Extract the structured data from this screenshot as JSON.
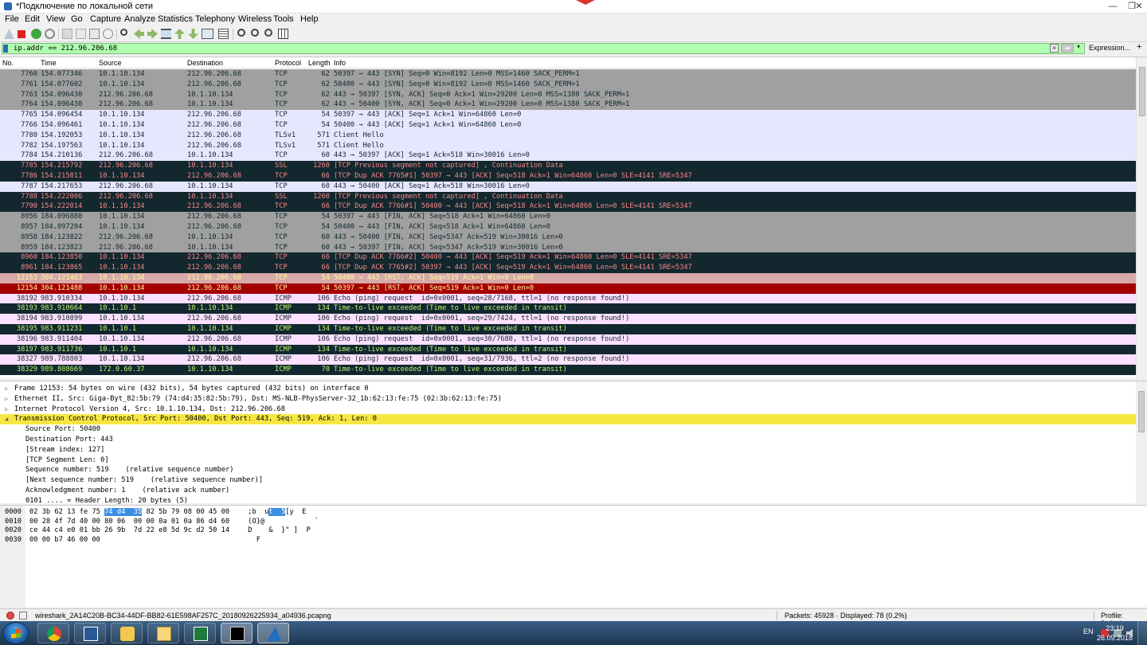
{
  "window": {
    "title": "*Подключение по локальной сети",
    "minimize": "—",
    "maximize": "❐",
    "close": "✕"
  },
  "menu": [
    "File",
    "Edit",
    "View",
    "Go",
    "Capture",
    "Analyze",
    "Statistics",
    "Telephony",
    "Wireless",
    "Tools",
    "Help"
  ],
  "filter": {
    "value": "ip.addr == 212.96.206.68",
    "clear_label": "✕",
    "apply_label": "➡",
    "dropdown": "▾",
    "expression_label": "Expression...",
    "add_label": "+"
  },
  "packet_list": {
    "columns": [
      "No.",
      "Time",
      "Source",
      "Destination",
      "Protocol",
      "Length",
      "Info"
    ],
    "rows": [
      {
        "no": "7760",
        "time": "154.077346",
        "src": "10.1.10.134",
        "dst": "212.96.206.68",
        "proto": "TCP",
        "len": "62",
        "info": "50397 → 443 [SYN] Seq=0 Win=8192 Len=0 MSS=1460 SACK_PERM=1",
        "bg": "#a0a0a0",
        "fg": "#12272e"
      },
      {
        "no": "7761",
        "time": "154.077602",
        "src": "10.1.10.134",
        "dst": "212.96.206.68",
        "proto": "TCP",
        "len": "62",
        "info": "50400 → 443 [SYN] Seq=0 Win=8192 Len=0 MSS=1460 SACK_PERM=1",
        "bg": "#a0a0a0",
        "fg": "#12272e"
      },
      {
        "no": "7763",
        "time": "154.096430",
        "src": "212.96.206.68",
        "dst": "10.1.10.134",
        "proto": "TCP",
        "len": "62",
        "info": "443 → 50397 [SYN, ACK] Seq=0 Ack=1 Win=29200 Len=0 MSS=1380 SACK_PERM=1",
        "bg": "#a0a0a0",
        "fg": "#12272e"
      },
      {
        "no": "7764",
        "time": "154.096430",
        "src": "212.96.206.68",
        "dst": "10.1.10.134",
        "proto": "TCP",
        "len": "62",
        "info": "443 → 50400 [SYN, ACK] Seq=0 Ack=1 Win=29200 Len=0 MSS=1380 SACK_PERM=1",
        "bg": "#a0a0a0",
        "fg": "#12272e"
      },
      {
        "no": "7765",
        "time": "154.096454",
        "src": "10.1.10.134",
        "dst": "212.96.206.68",
        "proto": "TCP",
        "len": "54",
        "info": "50397 → 443 [ACK] Seq=1 Ack=1 Win=64860 Len=0",
        "bg": "#e7e6ff",
        "fg": "#12272e"
      },
      {
        "no": "7766",
        "time": "154.096461",
        "src": "10.1.10.134",
        "dst": "212.96.206.68",
        "proto": "TCP",
        "len": "54",
        "info": "50400 → 443 [ACK] Seq=1 Ack=1 Win=64860 Len=0",
        "bg": "#e7e6ff",
        "fg": "#12272e"
      },
      {
        "no": "7780",
        "time": "154.192053",
        "src": "10.1.10.134",
        "dst": "212.96.206.68",
        "proto": "TLSv1",
        "len": "571",
        "info": "Client Hello",
        "bg": "#e7e6ff",
        "fg": "#12272e"
      },
      {
        "no": "7782",
        "time": "154.197563",
        "src": "10.1.10.134",
        "dst": "212.96.206.68",
        "proto": "TLSv1",
        "len": "571",
        "info": "Client Hello",
        "bg": "#e7e6ff",
        "fg": "#12272e"
      },
      {
        "no": "7784",
        "time": "154.210136",
        "src": "212.96.206.68",
        "dst": "10.1.10.134",
        "proto": "TCP",
        "len": "60",
        "info": "443 → 50397 [ACK] Seq=1 Ack=518 Win=30016 Len=0",
        "bg": "#e7e6ff",
        "fg": "#12272e"
      },
      {
        "no": "7785",
        "time": "154.215792",
        "src": "212.96.206.68",
        "dst": "10.1.10.134",
        "proto": "SSL",
        "len": "1260",
        "info": "[TCP Previous segment not captured] , Continuation Data",
        "bg": "#12272e",
        "fg": "#f78787"
      },
      {
        "no": "7786",
        "time": "154.215811",
        "src": "10.1.10.134",
        "dst": "212.96.206.68",
        "proto": "TCP",
        "len": "66",
        "info": "[TCP Dup ACK 7765#1] 50397 → 443 [ACK] Seq=518 Ack=1 Win=64860 Len=0 SLE=4141 SRE=5347",
        "bg": "#12272e",
        "fg": "#f78787"
      },
      {
        "no": "7787",
        "time": "154.217653",
        "src": "212.96.206.68",
        "dst": "10.1.10.134",
        "proto": "TCP",
        "len": "60",
        "info": "443 → 50400 [ACK] Seq=1 Ack=518 Win=30016 Len=0",
        "bg": "#e7e6ff",
        "fg": "#12272e"
      },
      {
        "no": "7788",
        "time": "154.222006",
        "src": "212.96.206.68",
        "dst": "10.1.10.134",
        "proto": "SSL",
        "len": "1260",
        "info": "[TCP Previous segment not captured] , Continuation Data",
        "bg": "#12272e",
        "fg": "#f78787"
      },
      {
        "no": "7790",
        "time": "154.222014",
        "src": "10.1.10.134",
        "dst": "212.96.206.68",
        "proto": "TCP",
        "len": "66",
        "info": "[TCP Dup ACK 7766#1] 50400 → 443 [ACK] Seq=518 Ack=1 Win=64860 Len=0 SLE=4141 SRE=5347",
        "bg": "#12272e",
        "fg": "#f78787"
      },
      {
        "no": "8956",
        "time": "184.096880",
        "src": "10.1.10.134",
        "dst": "212.96.206.68",
        "proto": "TCP",
        "len": "54",
        "info": "50397 → 443 [FIN, ACK] Seq=518 Ack=1 Win=64860 Len=0",
        "bg": "#a0a0a0",
        "fg": "#12272e"
      },
      {
        "no": "8957",
        "time": "184.097204",
        "src": "10.1.10.134",
        "dst": "212.96.206.68",
        "proto": "TCP",
        "len": "54",
        "info": "50400 → 443 [FIN, ACK] Seq=518 Ack=1 Win=64860 Len=0",
        "bg": "#a0a0a0",
        "fg": "#12272e"
      },
      {
        "no": "8958",
        "time": "184.123822",
        "src": "212.96.206.68",
        "dst": "10.1.10.134",
        "proto": "TCP",
        "len": "60",
        "info": "443 → 50400 [FIN, ACK] Seq=5347 Ack=519 Win=30016 Len=0",
        "bg": "#a0a0a0",
        "fg": "#12272e"
      },
      {
        "no": "8959",
        "time": "184.123823",
        "src": "212.96.206.68",
        "dst": "10.1.10.134",
        "proto": "TCP",
        "len": "60",
        "info": "443 → 50397 [FIN, ACK] Seq=5347 Ack=519 Win=30016 Len=0",
        "bg": "#a0a0a0",
        "fg": "#12272e"
      },
      {
        "no": "8960",
        "time": "184.123850",
        "src": "10.1.10.134",
        "dst": "212.96.206.68",
        "proto": "TCP",
        "len": "66",
        "info": "[TCP Dup ACK 7766#2] 50400 → 443 [ACK] Seq=519 Ack=1 Win=64860 Len=0 SLE=4141 SRE=5347",
        "bg": "#12272e",
        "fg": "#f78787"
      },
      {
        "no": "8961",
        "time": "184.123865",
        "src": "10.1.10.134",
        "dst": "212.96.206.68",
        "proto": "TCP",
        "len": "66",
        "info": "[TCP Dup ACK 7765#2] 50397 → 443 [ACK] Seq=519 Ack=1 Win=64860 Len=0 SLE=4141 SRE=5347",
        "bg": "#12272e",
        "fg": "#f78787"
      },
      {
        "no": "12153",
        "time": "304.121463",
        "src": "10.1.10.134",
        "dst": "212.96.206.68",
        "proto": "TCP",
        "len": "54",
        "info": "50400 → 443 [RST, ACK] Seq=519 Ack=1 Win=0 Len=0",
        "bg": "#d7a9a9",
        "fg": "#fffc9c"
      },
      {
        "no": "12154",
        "time": "304.121488",
        "src": "10.1.10.134",
        "dst": "212.96.206.68",
        "proto": "TCP",
        "len": "54",
        "info": "50397 → 443 [RST, ACK] Seq=519 Ack=1 Win=0 Len=0",
        "bg": "#a40000",
        "fg": "#fffc9c"
      },
      {
        "no": "38192",
        "time": "983.910334",
        "src": "10.1.10.134",
        "dst": "212.96.206.68",
        "proto": "ICMP",
        "len": "106",
        "info": "Echo (ping) request  id=0x0001, seq=28/7168, ttl=1 (no response found!)",
        "bg": "#fce0ff",
        "fg": "#12272e"
      },
      {
        "no": "38193",
        "time": "983.910664",
        "src": "10.1.10.1",
        "dst": "10.1.10.134",
        "proto": "ICMP",
        "len": "134",
        "info": "Time-to-live exceeded (Time to live exceeded in transit)",
        "bg": "#12272e",
        "fg": "#b7f774"
      },
      {
        "no": "38194",
        "time": "983.910899",
        "src": "10.1.10.134",
        "dst": "212.96.206.68",
        "proto": "ICMP",
        "len": "106",
        "info": "Echo (ping) request  id=0x0001, seq=29/7424, ttl=1 (no response found!)",
        "bg": "#fce0ff",
        "fg": "#12272e"
      },
      {
        "no": "38195",
        "time": "983.911231",
        "src": "10.1.10.1",
        "dst": "10.1.10.134",
        "proto": "ICMP",
        "len": "134",
        "info": "Time-to-live exceeded (Time to live exceeded in transit)",
        "bg": "#12272e",
        "fg": "#b7f774"
      },
      {
        "no": "38196",
        "time": "983.911404",
        "src": "10.1.10.134",
        "dst": "212.96.206.68",
        "proto": "ICMP",
        "len": "106",
        "info": "Echo (ping) request  id=0x0001, seq=30/7680, ttl=1 (no response found!)",
        "bg": "#fce0ff",
        "fg": "#12272e"
      },
      {
        "no": "38197",
        "time": "983.911736",
        "src": "10.1.10.1",
        "dst": "10.1.10.134",
        "proto": "ICMP",
        "len": "134",
        "info": "Time-to-live exceeded (Time to live exceeded in transit)",
        "bg": "#12272e",
        "fg": "#b7f774"
      },
      {
        "no": "38327",
        "time": "989.788803",
        "src": "10.1.10.134",
        "dst": "212.96.206.68",
        "proto": "ICMP",
        "len": "106",
        "info": "Echo (ping) request  id=0x0001, seq=31/7936, ttl=2 (no response found!)",
        "bg": "#fce0ff",
        "fg": "#12272e"
      },
      {
        "no": "38329",
        "time": "989.808669",
        "src": "172.0.60.37",
        "dst": "10.1.10.134",
        "proto": "ICMP",
        "len": "70",
        "info": "Time-to-live exceeded (Time to live exceeded in transit)",
        "bg": "#12272e",
        "fg": "#b7f774"
      }
    ]
  },
  "details": {
    "rows": [
      {
        "arrow": "▷",
        "indent": 0,
        "text": "Frame 12153: 54 bytes on wire (432 bits), 54 bytes captured (432 bits) on interface 0",
        "highlight": false
      },
      {
        "arrow": "▷",
        "indent": 0,
        "text": "Ethernet II, Src: Giga-Byt_82:5b:79 (74:d4:35:82:5b:79), Dst: MS-NLB-PhysServer-32_1b:62:13:fe:75 (02:3b:62:13:fe:75)",
        "highlight": false
      },
      {
        "arrow": "▷",
        "indent": 0,
        "text": "Internet Protocol Version 4, Src: 10.1.10.134, Dst: 212.96.206.68",
        "highlight": false
      },
      {
        "arrow": "◢",
        "indent": 0,
        "text": "Transmission Control Protocol, Src Port: 50400, Dst Port: 443, Seq: 519, Ack: 1, Len: 0",
        "highlight": true
      },
      {
        "arrow": "",
        "indent": 1,
        "text": "Source Port: 50400",
        "highlight": false
      },
      {
        "arrow": "",
        "indent": 1,
        "text": "Destination Port: 443",
        "highlight": false
      },
      {
        "arrow": "",
        "indent": 1,
        "text": "[Stream index: 127]",
        "highlight": false
      },
      {
        "arrow": "",
        "indent": 1,
        "text": "[TCP Segment Len: 0]",
        "highlight": false
      },
      {
        "arrow": "",
        "indent": 1,
        "text": "Sequence number: 519    (relative sequence number)",
        "highlight": false
      },
      {
        "arrow": "",
        "indent": 1,
        "text": "[Next sequence number: 519    (relative sequence number)]",
        "highlight": false
      },
      {
        "arrow": "",
        "indent": 1,
        "text": "Acknowledgment number: 1    (relative ack number)",
        "highlight": false
      },
      {
        "arrow": "",
        "indent": 1,
        "text": "0101 .... = Header Length: 20 bytes (5)",
        "highlight": false
      }
    ]
  },
  "bytes": {
    "rows": [
      {
        "offset": "0000",
        "hex_pre": "02 3b 62 13 fe 75 ",
        "hex_hl": "74 d4  35",
        "hex_post": " 82 5b 79 08 00 45 00",
        "asc_pre": " ;b  u",
        "asc_hl": "t  5",
        "asc_post": "[y  E"
      },
      {
        "offset": "0010",
        "hex_pre": "00 28 4f 7d 40 00 80 06  00 00 0a 01 0a 86 d4 60",
        "hex_hl": "",
        "hex_post": "",
        "asc_pre": " (O}@            `",
        "asc_hl": "",
        "asc_post": ""
      },
      {
        "offset": "0020",
        "hex_pre": "ce 44 c4 e0 01 bb 26 9b  7d 22 e8 5d 9c d2 50 14",
        "hex_hl": "",
        "hex_post": "",
        "asc_pre": " D    &  }\" ]  P",
        "asc_hl": "",
        "asc_post": ""
      },
      {
        "offset": "0030",
        "hex_pre": "00 00 b7 46 00 00",
        "hex_hl": "",
        "hex_post": "",
        "asc_pre": "   F  ",
        "asc_hl": "",
        "asc_post": ""
      }
    ]
  },
  "status": {
    "file": "wireshark_2A14C20B-BC34-44DF-BB82-61E598AF257C_20180926225934_a04936.pcapng",
    "packets": "Packets: 45928 · Displayed: 78 (0.2%)",
    "profile": "Profile: Default"
  },
  "taskbar": {
    "lang": "EN",
    "time": "23:19",
    "date": "26.09.2018",
    "apps": [
      "chrome-icon",
      "word-icon",
      "explorer-icon",
      "files-icon",
      "excel-icon",
      "cmd-icon",
      "wireshark-icon"
    ]
  }
}
